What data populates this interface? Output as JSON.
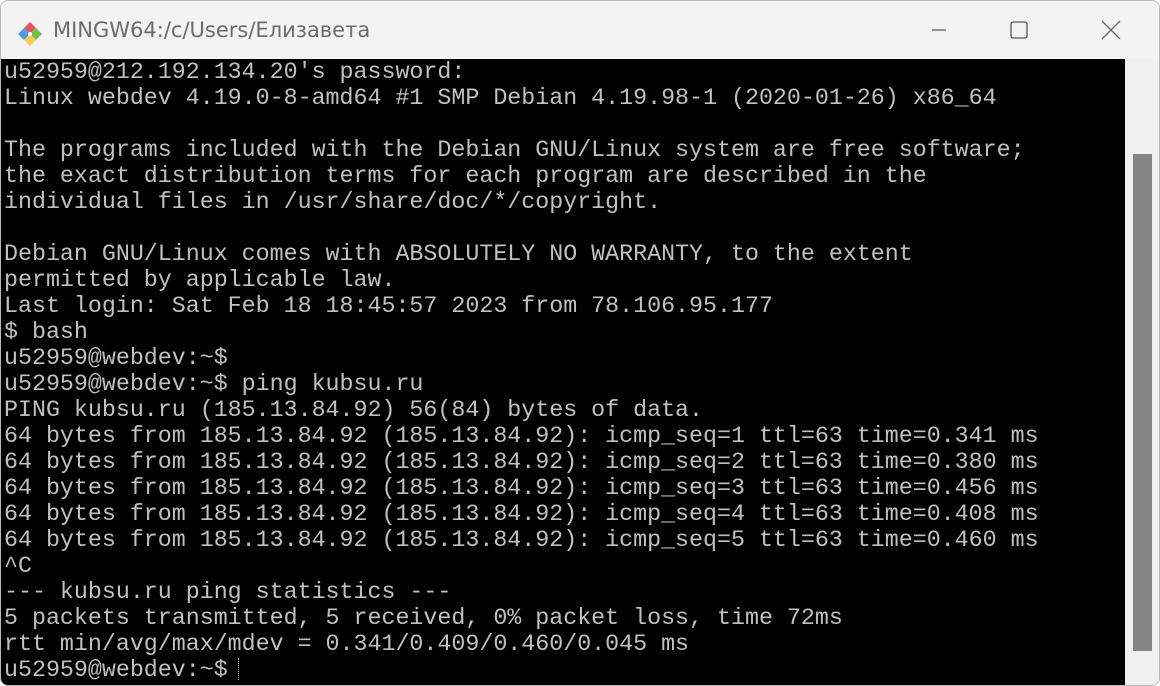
{
  "window": {
    "title": "MINGW64:/c/Users/Елизавета"
  },
  "terminal": {
    "lines": [
      "u52959@212.192.134.20's password:",
      "Linux webdev 4.19.0-8-amd64 #1 SMP Debian 4.19.98-1 (2020-01-26) x86_64",
      "",
      "The programs included with the Debian GNU/Linux system are free software;",
      "the exact distribution terms for each program are described in the",
      "individual files in /usr/share/doc/*/copyright.",
      "",
      "Debian GNU/Linux comes with ABSOLUTELY NO WARRANTY, to the extent",
      "permitted by applicable law.",
      "Last login: Sat Feb 18 18:45:57 2023 from 78.106.95.177",
      "$ bash",
      "u52959@webdev:~$",
      "u52959@webdev:~$ ping kubsu.ru",
      "PING kubsu.ru (185.13.84.92) 56(84) bytes of data.",
      "64 bytes from 185.13.84.92 (185.13.84.92): icmp_seq=1 ttl=63 time=0.341 ms",
      "64 bytes from 185.13.84.92 (185.13.84.92): icmp_seq=2 ttl=63 time=0.380 ms",
      "64 bytes from 185.13.84.92 (185.13.84.92): icmp_seq=3 ttl=63 time=0.456 ms",
      "64 bytes from 185.13.84.92 (185.13.84.92): icmp_seq=4 ttl=63 time=0.408 ms",
      "64 bytes from 185.13.84.92 (185.13.84.92): icmp_seq=5 ttl=63 time=0.460 ms",
      "^C",
      "--- kubsu.ru ping statistics ---",
      "5 packets transmitted, 5 received, 0% packet loss, time 72ms",
      "rtt min/avg/max/mdev = 0.341/0.409/0.460/0.045 ms"
    ],
    "prompt": "u52959@webdev:~$"
  },
  "colors": {
    "terminal_bg": "#000000",
    "terminal_fg": "#c0c0c0",
    "scroll_thumb": "#858585"
  }
}
